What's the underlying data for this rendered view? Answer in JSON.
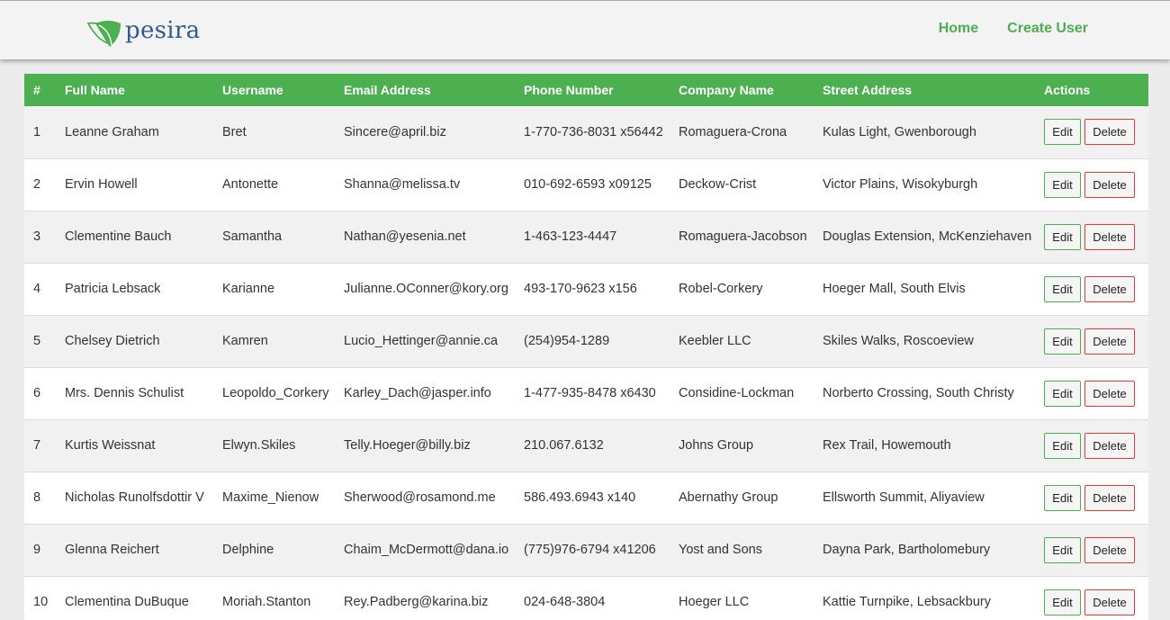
{
  "brand": {
    "name": "pesira"
  },
  "nav": {
    "home": "Home",
    "create_user": "Create User"
  },
  "colors": {
    "accent": "#4caf50",
    "link": "#4cae4f",
    "danger": "#e53935",
    "brand_text": "#2f5a93"
  },
  "table": {
    "headers": [
      "#",
      "Full Name",
      "Username",
      "Email Address",
      "Phone Number",
      "Company Name",
      "Street Address",
      "Actions"
    ],
    "rows": [
      {
        "id": "1",
        "name": "Leanne Graham",
        "username": "Bret",
        "email": "Sincere@april.biz",
        "phone": "1-770-736-8031 x56442",
        "company": "Romaguera-Crona",
        "street": "Kulas Light, Gwenborough"
      },
      {
        "id": "2",
        "name": "Ervin Howell",
        "username": "Antonette",
        "email": "Shanna@melissa.tv",
        "phone": "010-692-6593 x09125",
        "company": "Deckow-Crist",
        "street": "Victor Plains, Wisokyburgh"
      },
      {
        "id": "3",
        "name": "Clementine Bauch",
        "username": "Samantha",
        "email": "Nathan@yesenia.net",
        "phone": "1-463-123-4447",
        "company": "Romaguera-Jacobson",
        "street": "Douglas Extension, McKenziehaven"
      },
      {
        "id": "4",
        "name": "Patricia Lebsack",
        "username": "Karianne",
        "email": "Julianne.OConner@kory.org",
        "phone": "493-170-9623 x156",
        "company": "Robel-Corkery",
        "street": "Hoeger Mall, South Elvis"
      },
      {
        "id": "5",
        "name": "Chelsey Dietrich",
        "username": "Kamren",
        "email": "Lucio_Hettinger@annie.ca",
        "phone": "(254)954-1289",
        "company": "Keebler LLC",
        "street": "Skiles Walks, Roscoeview"
      },
      {
        "id": "6",
        "name": "Mrs. Dennis Schulist",
        "username": "Leopoldo_Corkery",
        "email": "Karley_Dach@jasper.info",
        "phone": "1-477-935-8478 x6430",
        "company": "Considine-Lockman",
        "street": "Norberto Crossing, South Christy"
      },
      {
        "id": "7",
        "name": "Kurtis Weissnat",
        "username": "Elwyn.Skiles",
        "email": "Telly.Hoeger@billy.biz",
        "phone": "210.067.6132",
        "company": "Johns Group",
        "street": "Rex Trail, Howemouth"
      },
      {
        "id": "8",
        "name": "Nicholas Runolfsdottir V",
        "username": "Maxime_Nienow",
        "email": "Sherwood@rosamond.me",
        "phone": "586.493.6943 x140",
        "company": "Abernathy Group",
        "street": "Ellsworth Summit, Aliyaview"
      },
      {
        "id": "9",
        "name": "Glenna Reichert",
        "username": "Delphine",
        "email": "Chaim_McDermott@dana.io",
        "phone": "(775)976-6794 x41206",
        "company": "Yost and Sons",
        "street": "Dayna Park, Bartholomebury"
      },
      {
        "id": "10",
        "name": "Clementina DuBuque",
        "username": "Moriah.Stanton",
        "email": "Rey.Padberg@karina.biz",
        "phone": "024-648-3804",
        "company": "Hoeger LLC",
        "street": "Kattie Turnpike, Lebsackbury"
      }
    ],
    "actions": {
      "edit": "Edit",
      "delete": "Delete"
    }
  }
}
